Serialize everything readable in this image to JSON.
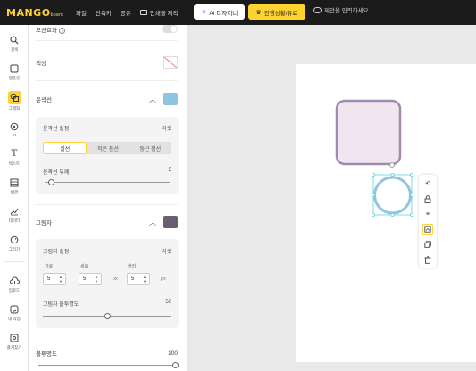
{
  "topbar": {
    "logo": "MANGO",
    "logo_sub": "board",
    "menu": [
      "파일",
      "단축키",
      "공유",
      "인쇄물 제작"
    ],
    "ai_button": "AI 디자이너",
    "publish_button": "진행상황/유료",
    "comment_button": "제안을 입력하세요",
    "colors": {
      "bg": "#1b1b1b",
      "accent": "#ffd230"
    }
  },
  "sidebar": {
    "items": [
      {
        "label": "검색",
        "icon": "search-icon"
      },
      {
        "label": "템플릿",
        "icon": "template-icon"
      },
      {
        "label": "그래픽",
        "icon": "graphic-icon"
      },
      {
        "label": "AI",
        "icon": "ai-icon"
      },
      {
        "label": "텍스트",
        "icon": "text-icon"
      },
      {
        "label": "배경",
        "icon": "background-icon"
      },
      {
        "label": "데이터",
        "icon": "chart-icon"
      },
      {
        "label": "그리기",
        "icon": "draw-icon"
      },
      {
        "label": "업로드",
        "icon": "upload-icon"
      },
      {
        "label": "내 작업",
        "icon": "my-work-icon"
      },
      {
        "label": "즐겨찾기",
        "icon": "favorite-icon"
      }
    ],
    "active_index": 2
  },
  "panel": {
    "opacity_label": "모션효과",
    "color_label": "색상",
    "outline": {
      "title": "윤곽선",
      "color": "#8ec5e3",
      "settings_label": "윤곽선 설정",
      "reset": "리셋",
      "styles": [
        "실선",
        "작은 점선",
        "둥근 점선"
      ],
      "active_style": 0,
      "thickness_label": "윤곽선 두께",
      "thickness_value": "5",
      "thickness_fraction": 0.05
    },
    "shadow": {
      "title": "그림자",
      "color": "#6b5e72",
      "settings_label": "그림자 설정",
      "reset": "리셋",
      "x_label": "가로",
      "y_label": "세로",
      "blur_label": "블러",
      "x_value": "5",
      "y_value": "5",
      "blur_value": "5",
      "unit": "px",
      "opacity_label": "그림자 불투명도",
      "opacity_value": "50",
      "opacity_fraction": 0.5
    },
    "transparency": {
      "label": "불투명도",
      "value": "100",
      "fraction": 1.0
    }
  },
  "canvas": {
    "rounded_square": {
      "fill": "#f1e6ef",
      "stroke": "#a08ab0"
    },
    "circle": {
      "fill": "#ffffff",
      "stroke": "#8ec5e3"
    },
    "selection_color": "#5fd3e0"
  },
  "float_toolbar": {
    "icons": [
      "rotate-icon",
      "lock-icon",
      "unlink-icon",
      "layer-icon",
      "copy-icon",
      "trash-icon"
    ],
    "active_index": 3
  }
}
